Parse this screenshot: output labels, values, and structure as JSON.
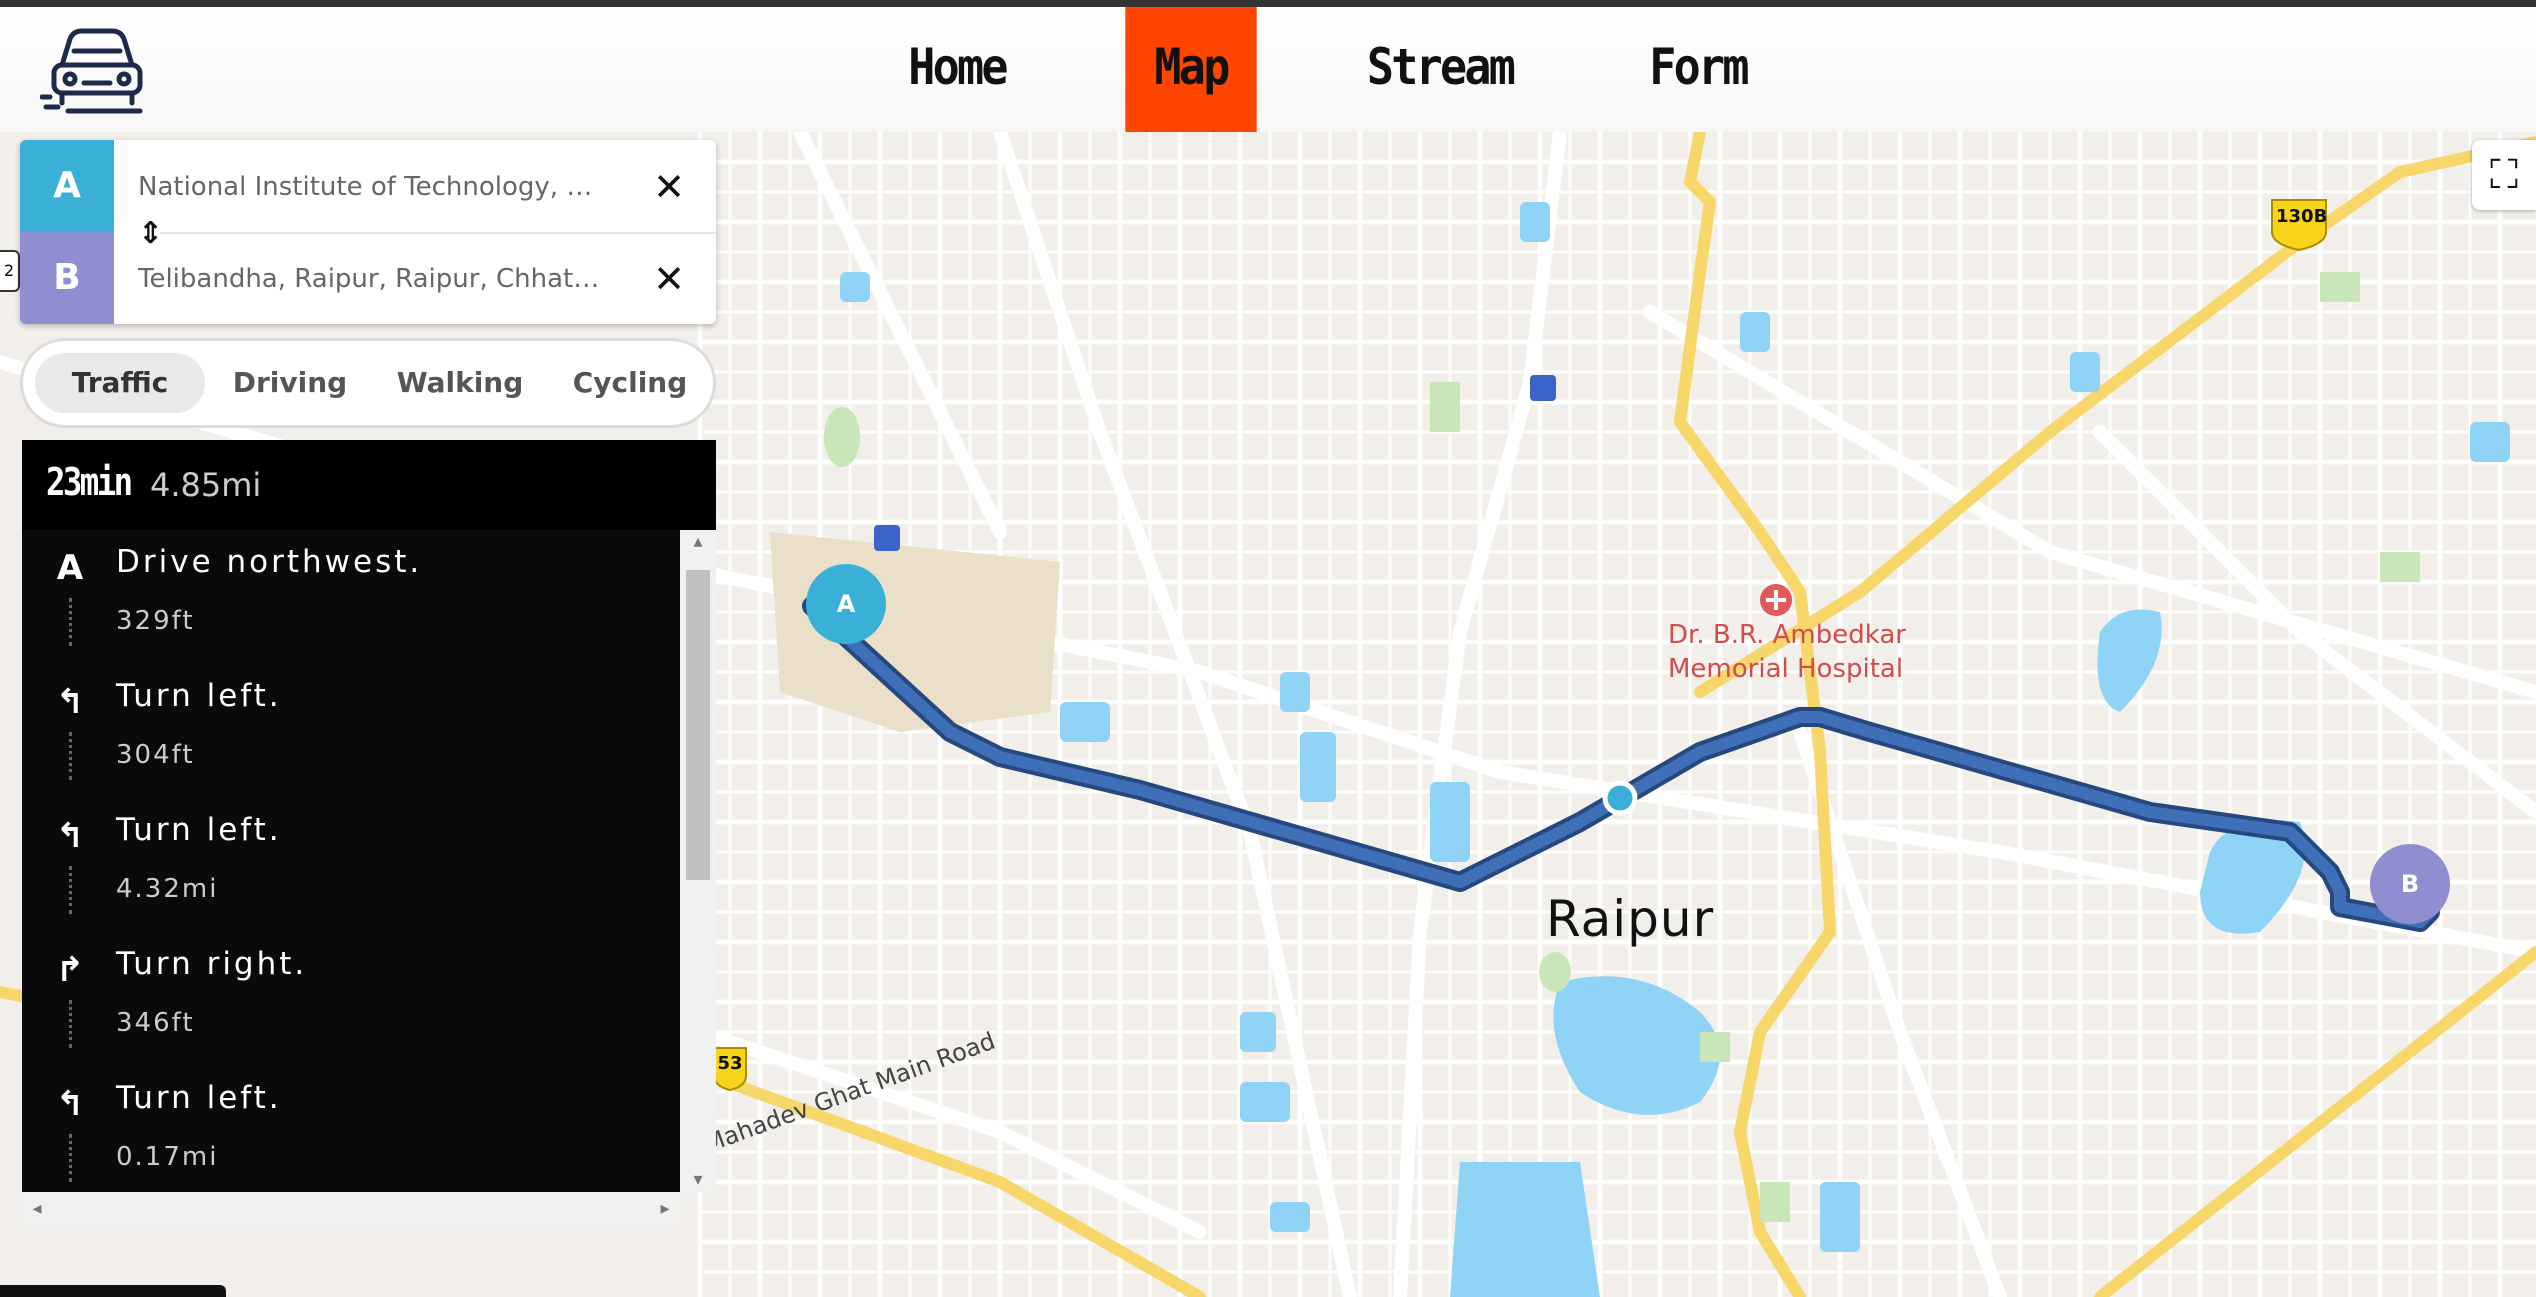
{
  "nav": {
    "items": [
      {
        "label": "Home",
        "active": false
      },
      {
        "label": "Map",
        "active": true
      },
      {
        "label": "Stream",
        "active": false
      },
      {
        "label": "Form",
        "active": false
      }
    ],
    "logo_icon": "car-icon",
    "active_color": "#ff4500"
  },
  "directions": {
    "origin": {
      "label": "A",
      "placeholder": "",
      "value": "National Institute of Technology, GE …",
      "color": "#3ab0d8"
    },
    "destination": {
      "label": "B",
      "placeholder": "",
      "value": "Telibandha, Raipur, Raipur, Chhattis…",
      "color": "#8e8ed0"
    },
    "clear_icon": "close-icon",
    "swap_icon": "swap-vertical-icon"
  },
  "modes": [
    {
      "label": "Traffic",
      "active": true
    },
    {
      "label": "Driving",
      "active": false
    },
    {
      "label": "Walking",
      "active": false
    },
    {
      "label": "Cycling",
      "active": false
    }
  ],
  "route": {
    "time": "23min",
    "distance": "4.85mi",
    "steps": [
      {
        "icon": "start-a-icon",
        "glyph": "A",
        "text": "Drive northwest.",
        "distance": "329ft"
      },
      {
        "icon": "turn-left-icon",
        "glyph": "↰",
        "text": "Turn left.",
        "distance": "304ft"
      },
      {
        "icon": "turn-left-icon",
        "glyph": "↰",
        "text": "Turn left.",
        "distance": "4.32mi"
      },
      {
        "icon": "turn-right-icon",
        "glyph": "↱",
        "text": "Turn right.",
        "distance": "346ft"
      },
      {
        "icon": "turn-left-icon",
        "glyph": "↰",
        "text": "Turn left.",
        "distance": "0.17mi"
      }
    ]
  },
  "map": {
    "city_label": "Raipur",
    "hospital_label_line1": "Dr. B.R. Ambedkar",
    "hospital_label_line2": "Memorial Hospital",
    "road_label": "Mahadev Ghat Main Road",
    "shield_130b": "130B",
    "shield_53": "53",
    "pin_a": "A",
    "pin_b": "B",
    "fullscreen_icon": "fullscreen-icon",
    "left_tab_text": "2",
    "route_color": "#3f6fb6"
  }
}
